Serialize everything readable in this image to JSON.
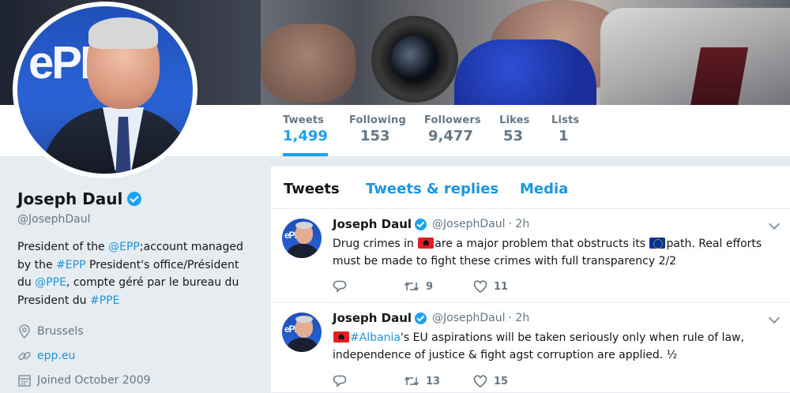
{
  "profile": {
    "name": "Joseph Daul",
    "handle": "@JosephDaul",
    "bio": {
      "p1": "President of the ",
      "link1": "@EPP",
      "p2": ";account managed by the ",
      "link2": "#EPP",
      "p3": " President's office/Président du ",
      "link3": "@PPE",
      "p4": ", compte géré par le bureau du President du ",
      "link4": "#PPE"
    },
    "location": "Brussels",
    "website": "epp.eu",
    "joined": "Joined October 2009"
  },
  "stats": [
    {
      "label": "Tweets",
      "value": "1,499"
    },
    {
      "label": "Following",
      "value": "153"
    },
    {
      "label": "Followers",
      "value": "9,477"
    },
    {
      "label": "Likes",
      "value": "53"
    },
    {
      "label": "Lists",
      "value": "1"
    }
  ],
  "tabs": [
    "Tweets",
    "Tweets & replies",
    "Media"
  ],
  "tweets": [
    {
      "name": "Joseph Daul",
      "handle": "@JosephDaul",
      "time": "· 2h",
      "text": {
        "a": "Drug crimes in ",
        "b": "are a major problem that obstructs its ",
        "c": "path. Real efforts must be made to fight these crimes with full transparency 2/2"
      },
      "replies": "",
      "retweets": "9",
      "likes": "11"
    },
    {
      "name": "Joseph Daul",
      "handle": "@JosephDaul",
      "time": "· 2h",
      "text": {
        "link": "#Albania",
        "a": "'s EU aspirations will be taken seriously only when rule of law, independence of justice & fight agst corruption are applied. ½"
      },
      "replies": "",
      "retweets": "13",
      "likes": "15"
    }
  ],
  "colors": {
    "accent": "#1da1f2",
    "link": "#1b95e0",
    "muted": "#657786",
    "background": "#e6ecf0"
  }
}
